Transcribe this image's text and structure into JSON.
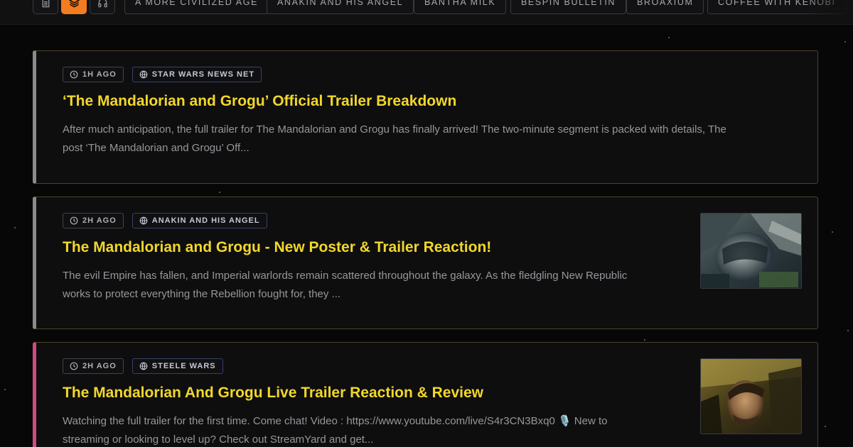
{
  "toolbar": {
    "views": [
      {
        "icon": "document-icon",
        "active": false
      },
      {
        "icon": "layers-icon",
        "active": true
      },
      {
        "icon": "headphones-icon",
        "active": false
      }
    ],
    "sources": [
      "A MORE CIVILIZED AGE",
      "ANAKIN AND HIS ANGEL",
      "BANTHA MILK",
      "BESPIN BULLETIN",
      "BROAXIUM",
      "COFFEE WITH KENOBI"
    ]
  },
  "articles": [
    {
      "time": "1H AGO",
      "source": "STAR WARS NEWS NET",
      "title": "‘The Mandalorian and Grogu’ Official Trailer Breakdown",
      "excerpt_line1": "After much anticipation, the full trailer for The Mandalorian and Grogu has finally arrived! The two-minute segment is packed with details, The",
      "excerpt_line2": "post ‘The Mandalorian and Grogu’ Off...",
      "accent": "#8b8b8b",
      "has_thumbnail": false
    },
    {
      "time": "2H AGO",
      "source": "ANAKIN AND HIS ANGEL",
      "title": "The Mandalorian and Grogu - New Poster & Trailer Reaction!",
      "excerpt_line1": "The evil Empire has fallen, and Imperial warlords remain scattered throughout the galaxy. As the fledgling New Republic",
      "excerpt_line2": "works to protect everything the Rebellion fought for, they ...",
      "accent": "#8b8b8b",
      "has_thumbnail": true
    },
    {
      "time": "2H AGO",
      "source": "STEELE WARS",
      "title": "The Mandalorian And Grogu Live Trailer Reaction & Review",
      "excerpt_line1": "Watching the full trailer for the first time. Come chat! Video : https://www.youtube.com/live/S4r3CN3Bxq0 🎙️ New to",
      "excerpt_line2": "streaming or looking to level up? Check out StreamYard and get...",
      "accent": "#d24a82",
      "has_thumbnail": true
    }
  ],
  "colors": {
    "background": "#070707",
    "title": "#f2d72a",
    "active_view": "#f47c20",
    "card_border": "#4a4426"
  }
}
